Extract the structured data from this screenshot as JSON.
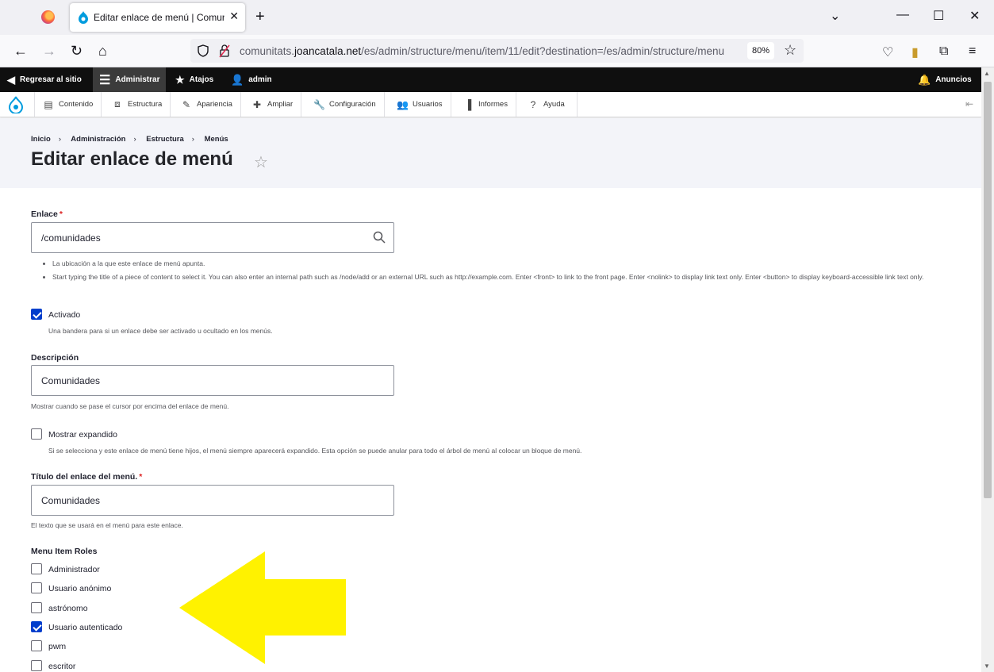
{
  "browser": {
    "tab_title": "Editar enlace de menú | Comunitats",
    "url_prefix": "comunitats.",
    "url_domain": "joancatala.net",
    "url_path": "/es/admin/structure/menu/item/11/edit?destination=/es/admin/structure/menu",
    "zoom": "80%"
  },
  "toolbar": {
    "back": "Regresar al sitio",
    "manage": "Administrar",
    "shortcuts": "Atajos",
    "user": "admin",
    "announcements": "Anuncios"
  },
  "tray": {
    "items": [
      "Contenido",
      "Estructura",
      "Apariencia",
      "Ampliar",
      "Configuración",
      "Usuarios",
      "Informes",
      "Ayuda"
    ]
  },
  "breadcrumb": [
    "Inicio",
    "Administración",
    "Estructura",
    "Menús"
  ],
  "page_title": "Editar enlace de menú",
  "form": {
    "link_label": "Enlace",
    "link_value": "/comunidades",
    "link_help_1": "La ubicación a la que este enlace de menú apunta.",
    "link_help_2": "Start typing the title of a piece of content to select it. You can also enter an internal path such as /node/add or an external URL such as http://example.com. Enter <front> to link to the front page. Enter <nolink> to display link text only. Enter <button> to display keyboard-accessible link text only.",
    "enabled_label": "Activado",
    "enabled_checked": true,
    "enabled_desc": "Una bandera para si un enlace debe ser activado u ocultado en los menús.",
    "description_label": "Descripción",
    "description_value": "Comunidades",
    "description_help": "Mostrar cuando se pase el cursor por encima del enlace de menú.",
    "expanded_label": "Mostrar expandido",
    "expanded_checked": false,
    "expanded_desc": "Si se selecciona y este enlace de menú tiene hijos, el menú siempre aparecerá expandido. Esta opción se puede anular para todo el árbol de menú al colocar un bloque de menú.",
    "title_label": "Título del enlace del menú.",
    "title_value": "Comunidades",
    "title_help": "El texto que se usará en el menú para este enlace.",
    "roles_label": "Menu Item Roles",
    "roles": [
      {
        "label": "Administrador",
        "checked": false
      },
      {
        "label": "Usuario anónimo",
        "checked": false
      },
      {
        "label": "astrónomo",
        "checked": false
      },
      {
        "label": "Usuario autenticado",
        "checked": true
      },
      {
        "label": "pwm",
        "checked": false
      },
      {
        "label": "escritor",
        "checked": false
      }
    ]
  },
  "colors": {
    "accent": "#003ecc",
    "toolbar": "#0f0f0f",
    "annotation_arrow": "#fff200"
  }
}
